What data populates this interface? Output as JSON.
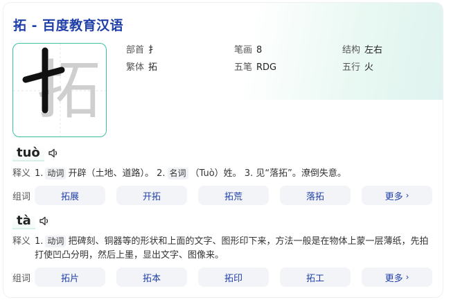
{
  "title": "拓 - 百度教育汉语",
  "character": "拓",
  "info": {
    "bushou_label": "部首",
    "bushou": "扌",
    "bihua_label": "笔画",
    "bihua": "8",
    "jiegou_label": "结构",
    "jiegou": "左右",
    "fanti_label": "繁体",
    "fanti": "拓",
    "wubi_label": "五笔",
    "wubi": "RDG",
    "wuxing_label": "五行",
    "wuxing": "火"
  },
  "readings": [
    {
      "pinyin": "tuò",
      "def_label": "释义",
      "def": {
        "n1": "1.",
        "pos1": "动词",
        "t1": "开辟（土地、道路）。",
        "n2": "2.",
        "pos2": "名词",
        "t2": "（Tuò）姓。",
        "n3": "3.",
        "t3": "见“落拓”。潦倒失意。"
      },
      "words_label": "组词",
      "words": [
        "拓展",
        "开拓",
        "拓荒",
        "落拓"
      ],
      "more": "更多"
    },
    {
      "pinyin": "tà",
      "def_label": "释义",
      "def": {
        "n1": "1.",
        "pos1": "动词",
        "t1": "把碑刻、铜器等的形状和上面的文字、图形印下来，方法一般是在物体上蒙一层薄纸，先拍",
        "t1b": "打使凹凸分明，然后上墨，显出文字、图像来。"
      },
      "words_label": "组词",
      "words": [
        "拓片",
        "拓本",
        "拓印",
        "拓工"
      ],
      "more": "更多"
    }
  ],
  "colors": {
    "title": "#1f3fa8",
    "accent": "#3fbfa4",
    "word": "#1f3fa8"
  }
}
